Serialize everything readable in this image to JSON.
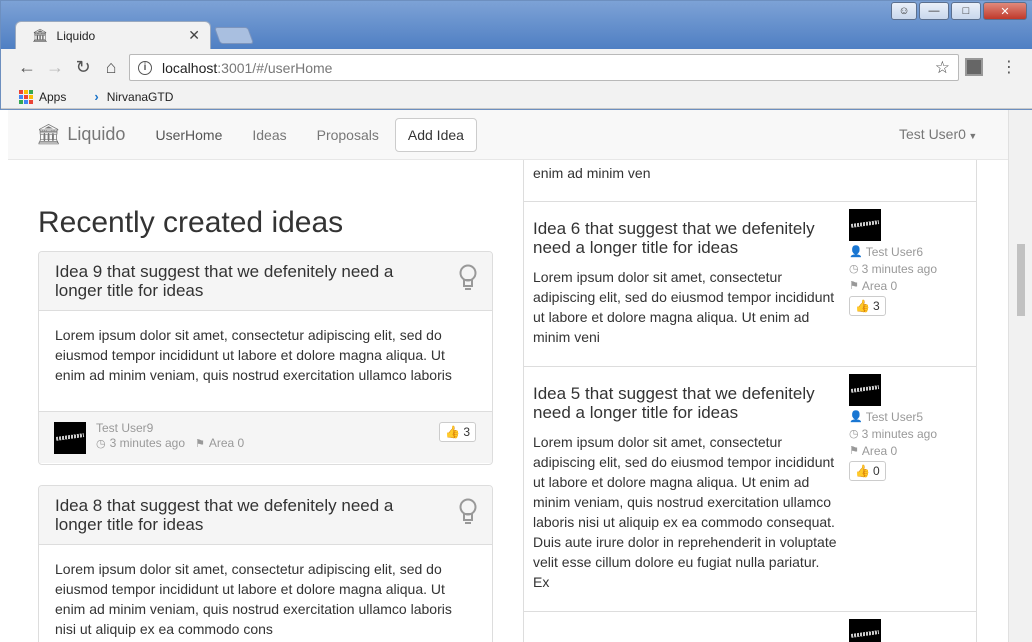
{
  "browser": {
    "tab_title": "Liquido",
    "url_host": "localhost",
    "url_rest": ":3001/#/userHome",
    "bookmarks": [
      {
        "label": "Apps"
      },
      {
        "label": "NirvanaGTD"
      }
    ]
  },
  "navbar": {
    "brand": "Liquido",
    "links": [
      "UserHome",
      "Ideas",
      "Proposals"
    ],
    "add_idea": "Add Idea",
    "user": "Test User0"
  },
  "section_title": "Recently created ideas",
  "left_cards": [
    {
      "title": "Idea 9 that suggest that we defenitely need a longer title for ideas",
      "body": "Lorem ipsum dolor sit amet, consectetur adipiscing elit, sed do eiusmod tempor incididunt ut labore et dolore magna aliqua. Ut enim ad minim veniam, quis nostrud exercitation ullamco laboris",
      "user": "Test User9",
      "time": "3 minutes ago",
      "area": "Area 0",
      "likes": "3"
    },
    {
      "title": "Idea 8 that suggest that we defenitely need a longer title for ideas",
      "body": "Lorem ipsum dolor sit amet, consectetur adipiscing elit, sed do eiusmod tempor incididunt ut labore et dolore magna aliqua. Ut enim ad minim veniam, quis nostrud exercitation ullamco laboris nisi ut aliquip ex ea commodo cons"
    }
  ],
  "right_list": {
    "top_fragment": "enim ad minim ven",
    "items": [
      {
        "title": "Idea 6 that suggest that we defenitely need a longer title for ideas",
        "body": "Lorem ipsum dolor sit amet, consectetur adipiscing elit, sed do eiusmod tempor incididunt ut labore et dolore magna aliqua. Ut enim ad minim veni",
        "user": "Test User6",
        "time": "3 minutes ago",
        "area": "Area 0",
        "likes": "3"
      },
      {
        "title": "Idea 5 that suggest that we defenitely need a longer title for ideas",
        "body": "Lorem ipsum dolor sit amet, consectetur adipiscing elit, sed do eiusmod tempor incididunt ut labore et dolore magna aliqua. Ut enim ad minim veniam, quis nostrud exercitation ullamco laboris nisi ut aliquip ex ea commodo consequat. Duis aute irure dolor in reprehenderit in voluptate velit esse cillum dolore eu fugiat nulla pariatur. Ex",
        "user": "Test User5",
        "time": "3 minutes ago",
        "area": "Area 0",
        "likes": "0"
      }
    ]
  }
}
